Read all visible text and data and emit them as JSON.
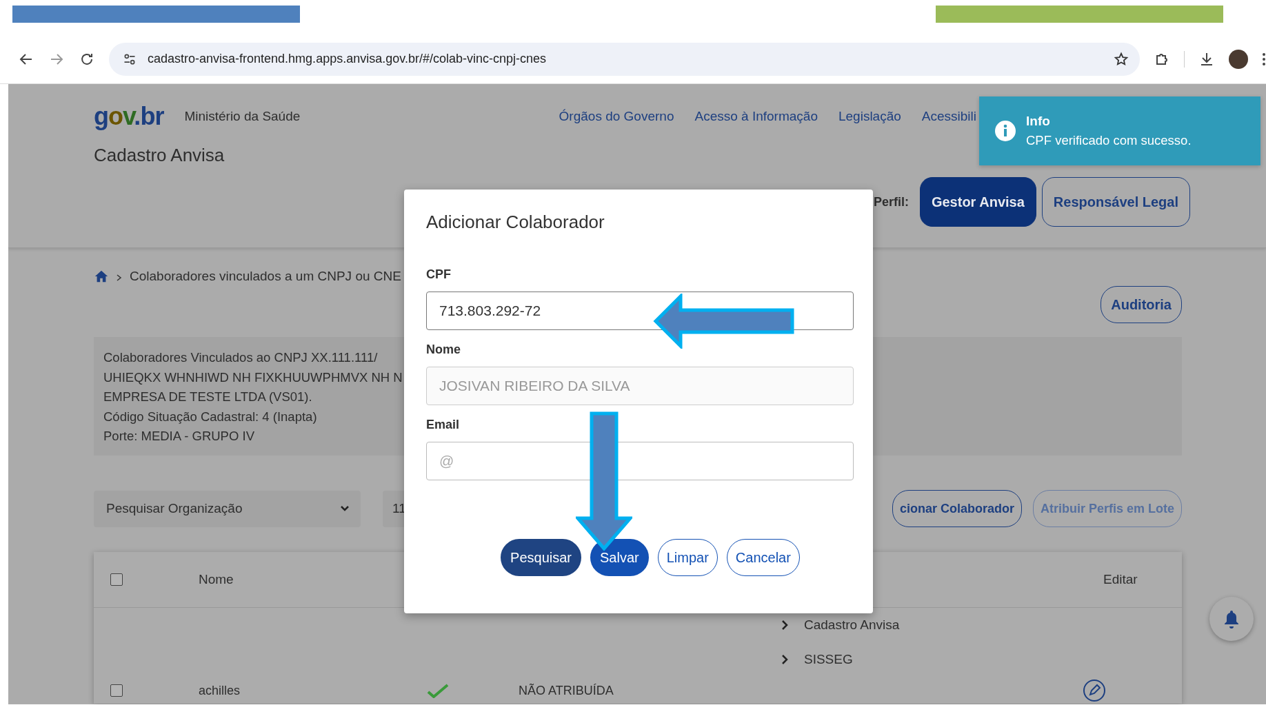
{
  "browser": {
    "url": "cadastro-anvisa-frontend.hmg.apps.anvisa.gov.br/#/colab-vinc-cnpj-cnes"
  },
  "header": {
    "logo": "gov.br",
    "ministry": "Ministério da Saúde",
    "nav": [
      "Órgãos do Governo",
      "Acesso à Informação",
      "Legislação",
      "Acessibili"
    ],
    "app_title": "Cadastro Anvisa",
    "profile_label": "Perfil:",
    "profiles": [
      {
        "label": "Gestor Anvisa",
        "selected": true
      },
      {
        "label": "Responsável Legal",
        "selected": false
      }
    ]
  },
  "toast": {
    "title": "Info",
    "message": "CPF verificado com sucesso."
  },
  "breadcrumb": "Colaboradores vinculados a um CNPJ ou CNE",
  "audit_button": "Auditoria",
  "info_lines": [
    "Colaboradores Vinculados ao CNPJ XX.111.111/",
    "UHIEQKX WHNHIWD NH FIXKHUUWPHMVX NH N",
    "EMPRESA DE TESTE LTDA (VS01).",
    "Código Situação Cadastral: 4 (Inapta)",
    "Porte: MEDIA - GRUPO IV"
  ],
  "filters": {
    "organization": "Pesquisar Organização",
    "field_2": "11"
  },
  "actions": [
    {
      "label": "cionar Colaborador",
      "disabled": false
    },
    {
      "label": "Atribuir Perfis em Lote",
      "disabled": true
    }
  ],
  "table": {
    "columns": [
      "Nome",
      "Editar"
    ],
    "header_checked": false,
    "groups": [
      "Cadastro Anvisa",
      "SISSEG"
    ],
    "rows": [
      {
        "name": "achilles",
        "checked": false,
        "status": "NÃO ATRIBUÍDA"
      }
    ]
  },
  "modal": {
    "title": "Adicionar Colaborador",
    "fields": [
      {
        "label": "CPF",
        "value": "713.803.292-72",
        "disabled": false
      },
      {
        "label": "Nome",
        "value": "JOSIVAN RIBEIRO DA SILVA",
        "disabled": true
      },
      {
        "label": "Email",
        "placeholder": "@",
        "disabled": false
      }
    ],
    "buttons": [
      {
        "label": "Pesquisar",
        "kind": "dark"
      },
      {
        "label": "Salvar",
        "kind": "primary"
      },
      {
        "label": "Limpar",
        "kind": "outline"
      },
      {
        "label": "Cancelar",
        "kind": "outline"
      }
    ]
  }
}
